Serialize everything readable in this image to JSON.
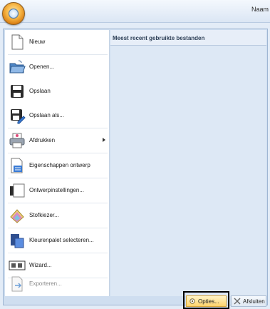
{
  "window": {
    "title": "Naam"
  },
  "menu": {
    "items": [
      {
        "id": "nieuw",
        "label": "Nieuw",
        "icon": "new-document-icon"
      },
      {
        "id": "openen",
        "label": "Openen...",
        "icon": "open-folder-icon"
      },
      {
        "id": "opslaan",
        "label": "Opslaan",
        "icon": "save-icon"
      },
      {
        "id": "opslaan-als",
        "label": "Opslaan als...",
        "icon": "save-as-icon"
      },
      {
        "id": "afdrukken",
        "label": "Afdrukken",
        "icon": "printer-icon",
        "submenu": true
      },
      {
        "id": "eigenschappen",
        "label": "Eigenschappen ontwerp",
        "icon": "design-properties-icon"
      },
      {
        "id": "ontwerpinstellingen",
        "label": "Ontwerpinstellingen...",
        "icon": "design-settings-icon"
      },
      {
        "id": "stofkiezer",
        "label": "Stofkiezer...",
        "icon": "fabric-selector-icon"
      },
      {
        "id": "kleurenpalet",
        "label": "Kleurenpalet selecteren...",
        "icon": "color-palette-icon"
      },
      {
        "id": "wizard",
        "label": "Wizard...",
        "icon": "wizard-icon"
      },
      {
        "id": "exporteren",
        "label": "Exporteren...",
        "icon": "export-icon",
        "disabled": true
      }
    ]
  },
  "recent": {
    "header": "Meest recent gebruikte bestanden"
  },
  "footer": {
    "options_label": "Opties...",
    "close_label": "Afsluiten"
  },
  "colors": {
    "accent_blue": "#2f6db5",
    "highlight_gold": "#ffd36b",
    "panel_bg": "#cfdef0"
  }
}
